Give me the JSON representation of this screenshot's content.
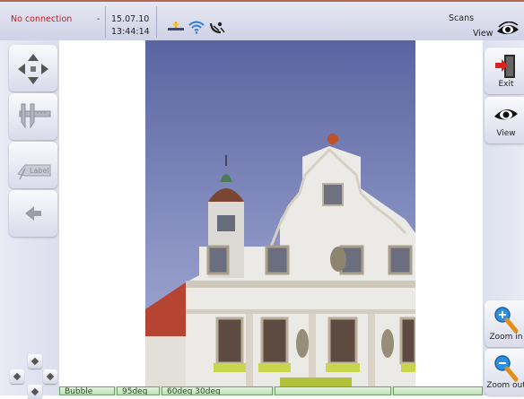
{
  "status": {
    "connection": "No connection",
    "separator": "-",
    "date": "15.07.10",
    "time": "13:44:14",
    "icons": [
      "level-tool-icon",
      "wifi-icon",
      "satellite-dish-icon"
    ]
  },
  "top_right": {
    "scans_label": "Scans",
    "view_label": "View",
    "icon": "eye-icon"
  },
  "left_toolbar": [
    {
      "name": "move-arrows-button",
      "icon": "four-way-arrows-icon"
    },
    {
      "name": "caliper-measure-button",
      "icon": "caliper-icon"
    },
    {
      "name": "label-tool-button",
      "icon": "label-tag-icon",
      "text": "Label"
    },
    {
      "name": "back-arrow-button",
      "icon": "left-arrow-icon"
    }
  ],
  "right_toolbar": {
    "exit_label": "Exit",
    "view_label": "View",
    "zoom_in_label": "Zoom in",
    "zoom_out_label": "Zoom out"
  },
  "bottom_bar": {
    "cells": [
      "Bubble",
      "95deg",
      "60deg 30deg",
      "",
      ""
    ]
  },
  "colors": {
    "connection_error": "#dd1111",
    "toolbar_bg": "#e4e6f2",
    "status_green": "#c8e4c0",
    "top_border": "#b06a55"
  }
}
